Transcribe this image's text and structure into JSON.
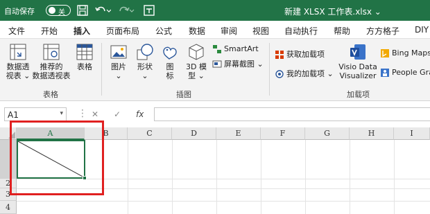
{
  "titlebar": {
    "autosave_label": "自动保存",
    "toggle_text": "关",
    "doc_title": "新建 XLSX 工作表.xlsx ⌄"
  },
  "tabs": [
    "文件",
    "开始",
    "插入",
    "页面布局",
    "公式",
    "数据",
    "审阅",
    "视图",
    "自动执行",
    "帮助",
    "方方格子",
    "DIY"
  ],
  "active_tab": "插入",
  "ribbon": {
    "pivot_line1": "数据透",
    "pivot_line2": "视表 ⌄",
    "recommended_line1": "推荐的",
    "recommended_line2": "数据透视表",
    "table": "表格",
    "group_tables": "表格",
    "picture_line1": "图片",
    "picture_line2": "⌄",
    "shapes_line1": "形状",
    "shapes_line2": "⌄",
    "icons_line1": "图",
    "icons_line2": "标",
    "model3d_line1": "3D 模",
    "model3d_line2": "型 ⌄",
    "smartart": "SmartArt",
    "screenshot": "屏幕截图 ⌄",
    "group_illustrations": "插图",
    "get_addins": "获取加载项",
    "my_addins": "我的加载项 ⌄",
    "visio_line1": "Visio Data",
    "visio_line2": "Visualizer",
    "bing_maps": "Bing Maps",
    "people_graph": "People Gra",
    "group_addins": "加载项"
  },
  "formula_bar": {
    "name_box": "A1",
    "cancel": "✕",
    "enter": "✓",
    "fx": "fx"
  },
  "sheet": {
    "columns": [
      "A",
      "B",
      "C",
      "D",
      "E",
      "F",
      "G",
      "H",
      "I"
    ],
    "rows": [
      "2",
      "3",
      "4"
    ]
  },
  "colors": {
    "excel_green": "#217346",
    "highlight_red": "#e02020"
  }
}
